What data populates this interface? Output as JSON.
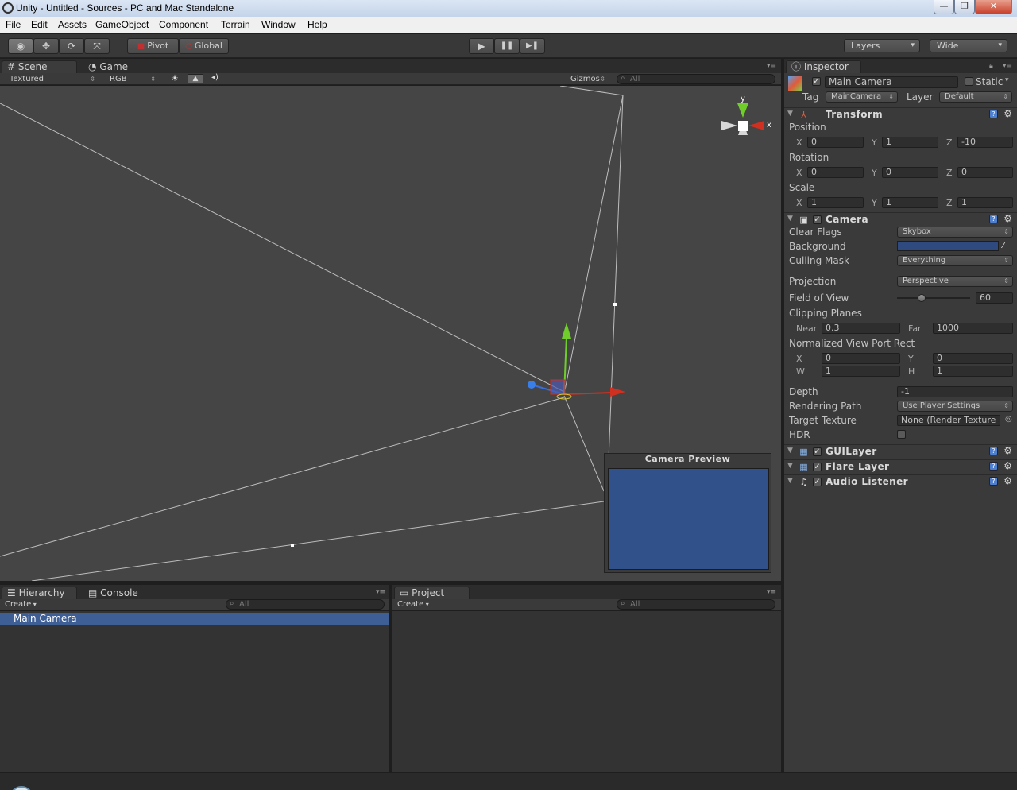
{
  "window": {
    "title": "Unity - Untitled - Sources - PC and Mac Standalone",
    "buttons": {
      "minimize": "—",
      "maximize": "❐",
      "close": "✕"
    }
  },
  "menu": [
    "File",
    "Edit",
    "Assets",
    "GameObject",
    "Component",
    "Terrain",
    "Window",
    "Help"
  ],
  "toolbar": {
    "pivot": "Pivot",
    "global": "Global",
    "play": "▶",
    "pause": "❚❚",
    "step": "▶❚",
    "layers": "Layers",
    "layout": "Wide"
  },
  "scene": {
    "tab_scene": "Scene",
    "tab_game": "Game",
    "render_mode": "Textured",
    "color_mode": "RGB",
    "gizmos": "Gizmos",
    "search_placeholder": "All",
    "gizmo_axes": {
      "y": "y",
      "x": "x"
    },
    "camera_preview_title": "Camera Preview",
    "camera_preview_color": "#31518a"
  },
  "hierarchy": {
    "tab": "Hierarchy",
    "tab_console": "Console",
    "create": "Create",
    "search_placeholder": "All",
    "items": [
      "Main Camera"
    ]
  },
  "project": {
    "tab": "Project",
    "create": "Create",
    "search_placeholder": "All"
  },
  "inspector": {
    "tab": "Inspector",
    "object_name": "Main Camera",
    "static_label": "Static",
    "tag_label": "Tag",
    "tag_value": "MainCamera",
    "layer_label": "Layer",
    "layer_value": "Default",
    "transform": {
      "title": "Transform",
      "position_label": "Position",
      "position": {
        "x": "0",
        "y": "1",
        "z": "-10"
      },
      "rotation_label": "Rotation",
      "rotation": {
        "x": "0",
        "y": "0",
        "z": "0"
      },
      "scale_label": "Scale",
      "scale": {
        "x": "1",
        "y": "1",
        "z": "1"
      },
      "axis_labels": {
        "x": "X",
        "y": "Y",
        "z": "Z"
      }
    },
    "camera": {
      "title": "Camera",
      "clear_flags_label": "Clear Flags",
      "clear_flags": "Skybox",
      "background_label": "Background",
      "background_color": "#2e4a7e",
      "culling_mask_label": "Culling Mask",
      "culling_mask": "Everything",
      "projection_label": "Projection",
      "projection": "Perspective",
      "fov_label": "Field of View",
      "fov": "60",
      "clipping_label": "Clipping Planes",
      "near_label": "Near",
      "near": "0.3",
      "far_label": "Far",
      "far": "1000",
      "viewport_label": "Normalized View Port Rect",
      "vp_x_label": "X",
      "vp_x": "0",
      "vp_y_label": "Y",
      "vp_y": "0",
      "vp_w_label": "W",
      "vp_w": "1",
      "vp_h_label": "H",
      "vp_h": "1",
      "depth_label": "Depth",
      "depth": "-1",
      "rendering_path_label": "Rendering Path",
      "rendering_path": "Use Player Settings",
      "target_texture_label": "Target Texture",
      "target_texture": "None (Render Texture",
      "hdr_label": "HDR"
    },
    "components": [
      "GUILayer",
      "Flare Layer",
      "Audio Listener"
    ]
  }
}
